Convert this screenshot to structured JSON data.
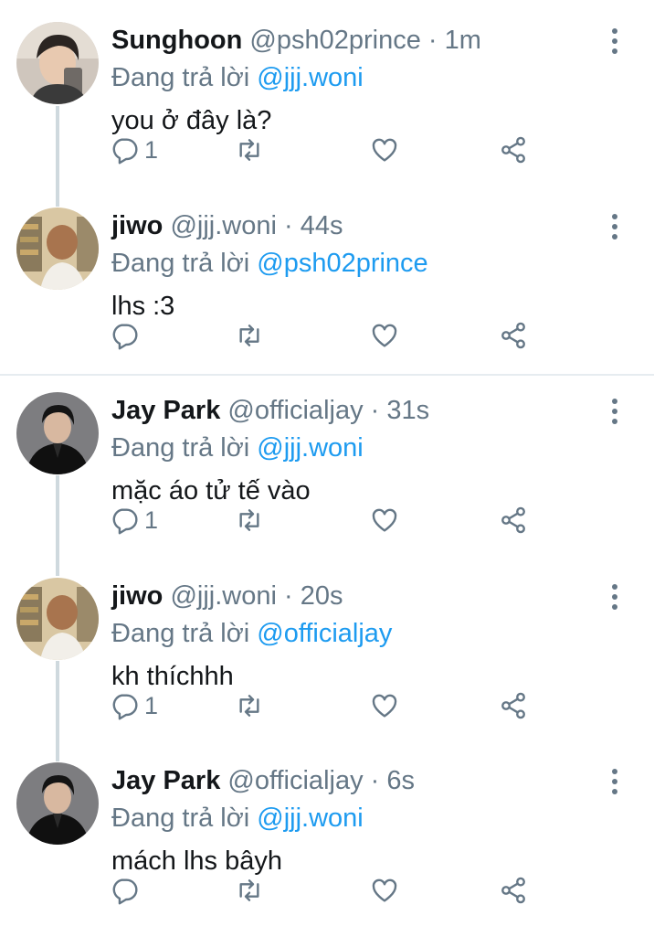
{
  "tweets": [
    {
      "name": "Sunghoon",
      "handle": "@psh02prince",
      "dot": "·",
      "time": "1m",
      "reply_prefix": "Đang trả lời ",
      "reply_to": "@jjj.woni",
      "text": "you ở đây là?",
      "reply_count": "1",
      "avatar": "sunghoon-avatar"
    },
    {
      "name": "jiwo",
      "handle": "@jjj.woni",
      "dot": "·",
      "time": "44s",
      "reply_prefix": "Đang trả lời ",
      "reply_to": "@psh02prince",
      "text": "lhs :3",
      "reply_count": "",
      "avatar": "jiwo-avatar"
    },
    {
      "name": "Jay Park",
      "handle": "@officialjay",
      "dot": "·",
      "time": "31s",
      "reply_prefix": "Đang trả lời ",
      "reply_to": "@jjj.woni",
      "text": "mặc áo tử tế vào",
      "reply_count": "1",
      "avatar": "jay-avatar"
    },
    {
      "name": "jiwo",
      "handle": "@jjj.woni",
      "dot": "·",
      "time": "20s",
      "reply_prefix": "Đang trả lời ",
      "reply_to": "@officialjay",
      "text": "kh thíchhh",
      "reply_count": "1",
      "avatar": "jiwo-avatar"
    },
    {
      "name": "Jay Park",
      "handle": "@officialjay",
      "dot": "·",
      "time": "6s",
      "reply_prefix": "Đang trả lời ",
      "reply_to": "@jjj.woni",
      "text": "mách lhs bâyh",
      "reply_count": "",
      "avatar": "jay-avatar"
    }
  ],
  "colors": {
    "mention": "#1d9bf0",
    "secondary_text": "#657786",
    "thread_line": "#cfd9de"
  }
}
